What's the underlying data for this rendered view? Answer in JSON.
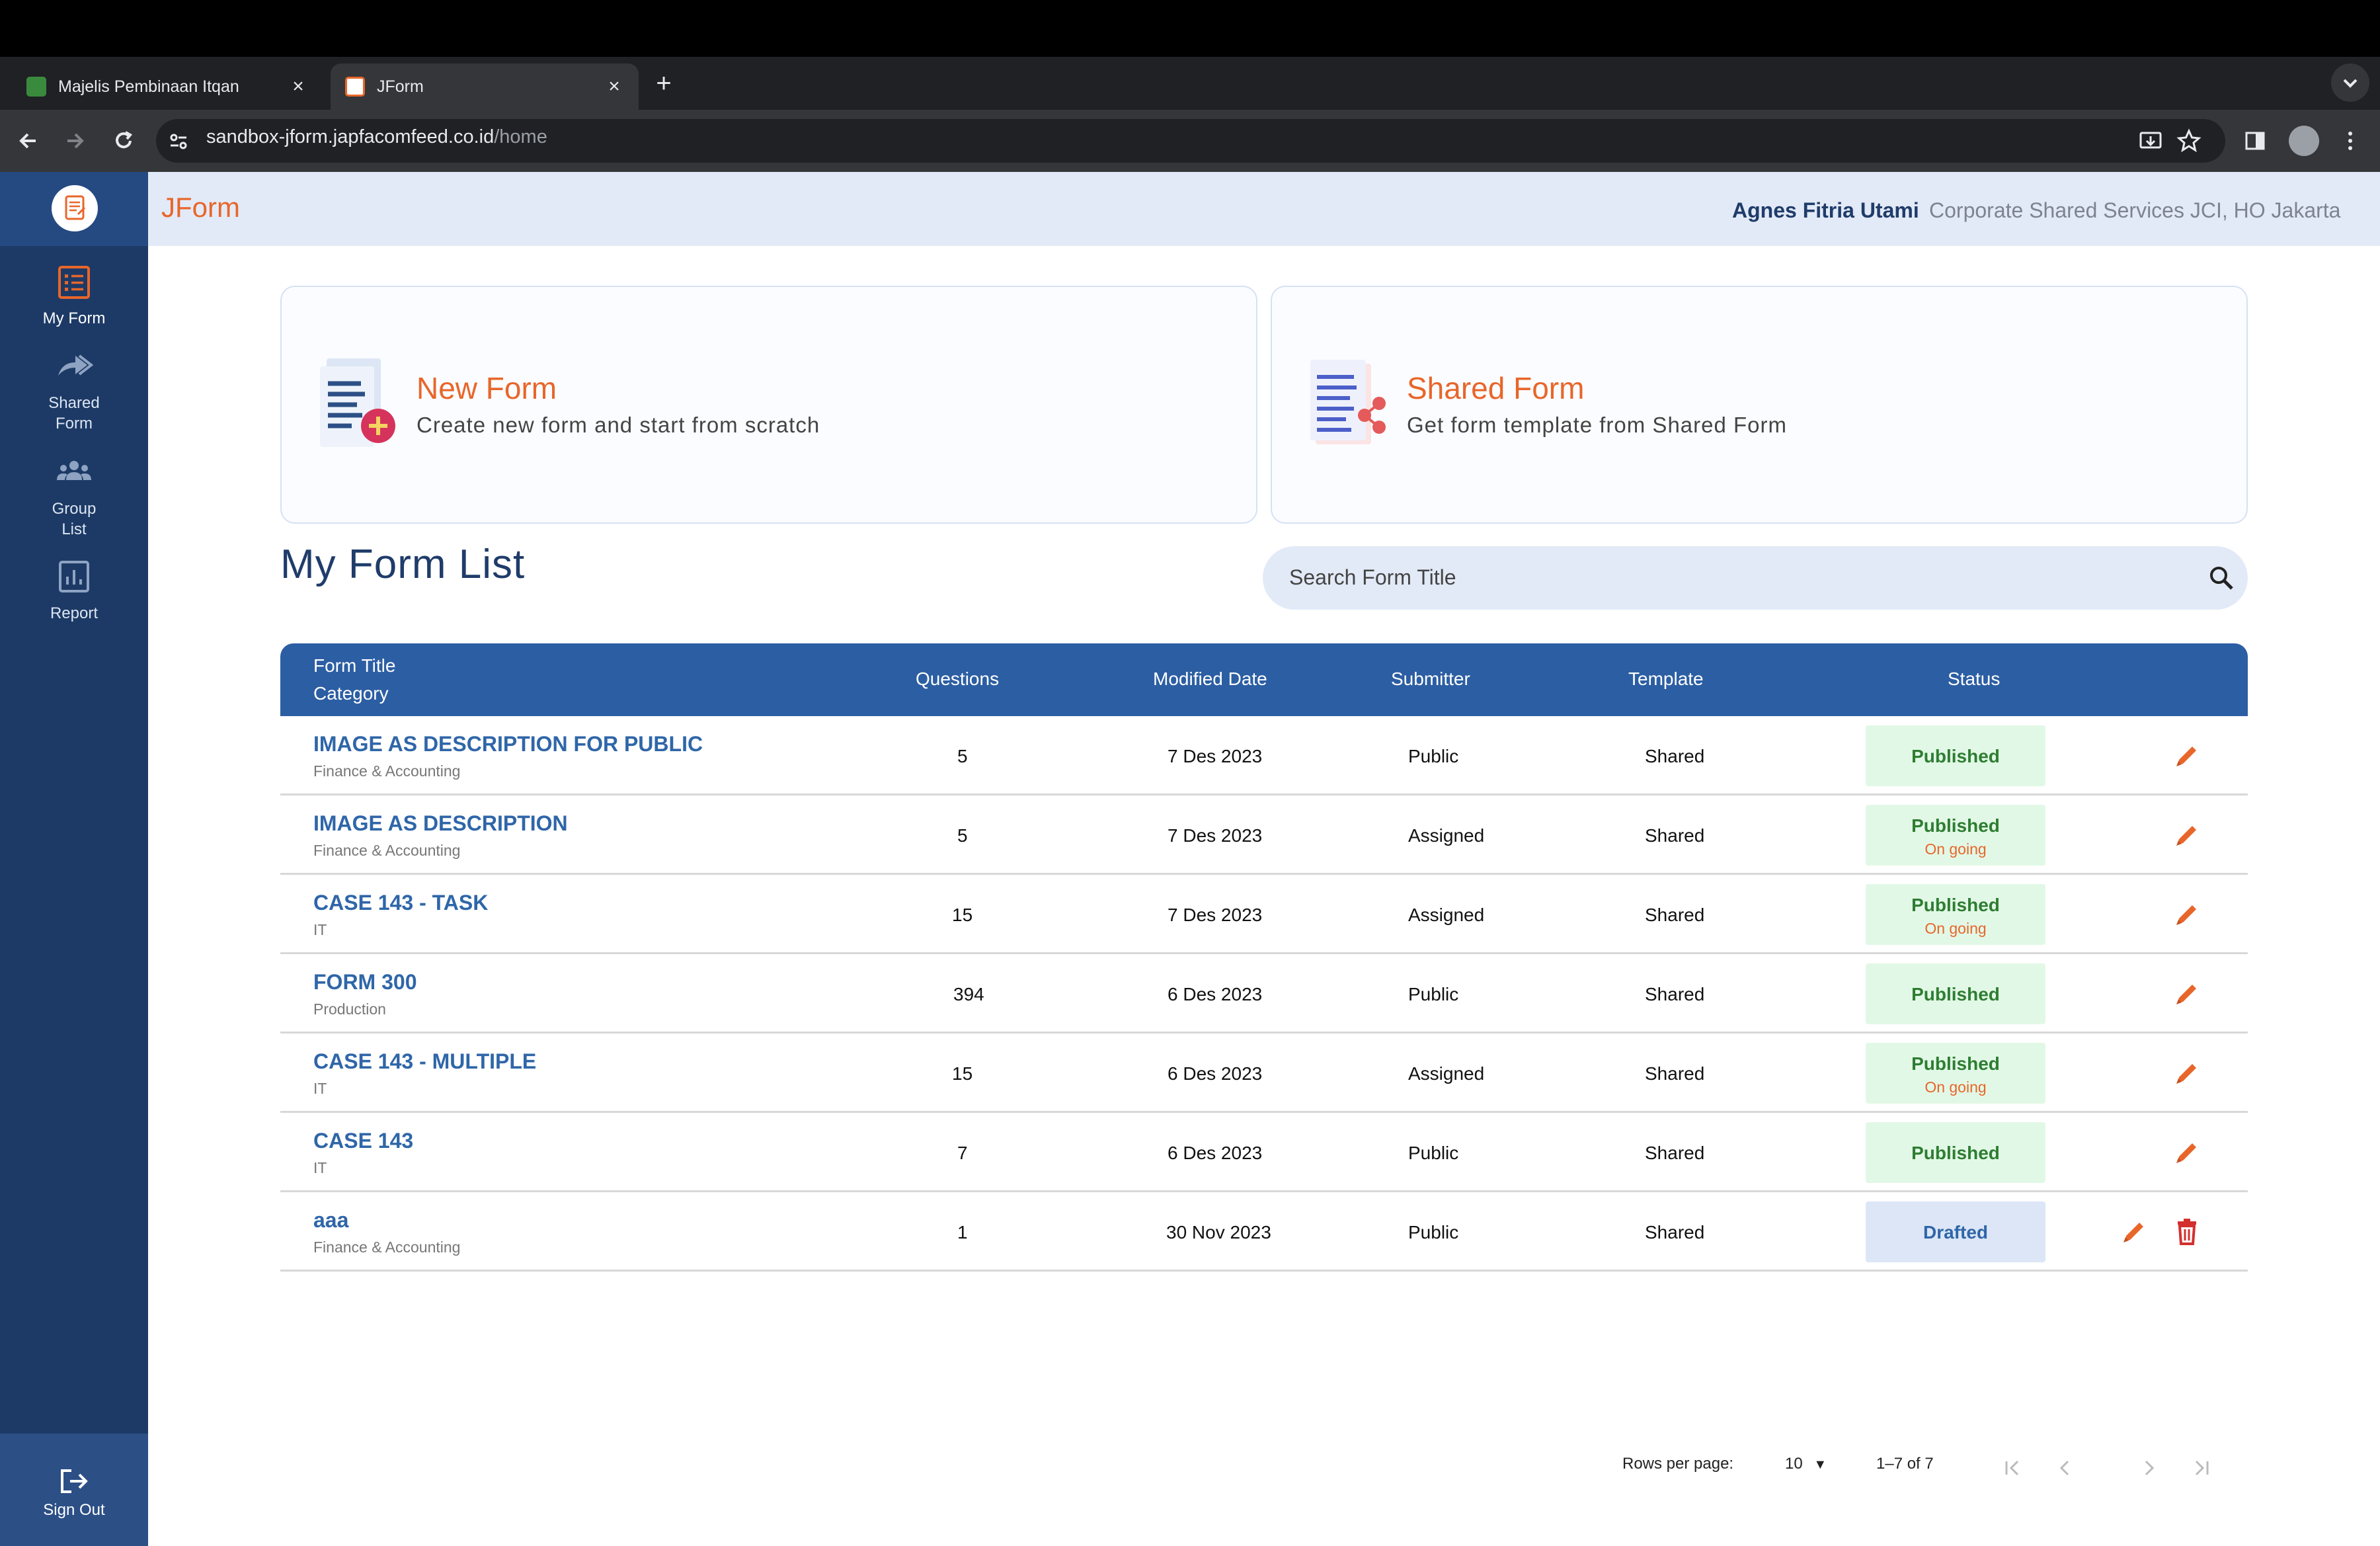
{
  "browser": {
    "tabs": [
      {
        "title": "Majelis Pembinaan Itqan",
        "active": false
      },
      {
        "title": "JForm",
        "active": true
      }
    ],
    "url_host": "sandbox-jform.japfacomfeed.co.id",
    "url_path": "/home"
  },
  "app": {
    "brand": "JForm",
    "user_name": "Agnes Fitria Utami",
    "user_org": "Corporate Shared Services JCI, HO Jakarta",
    "accent_color": "#e8662a",
    "primary_color": "#2c5ea3"
  },
  "sidebar": {
    "items": [
      {
        "label": "My Form",
        "icon": "list-icon",
        "active": true
      },
      {
        "label": "Shared Form",
        "icon": "share-arrows-icon",
        "active": false
      },
      {
        "label": "Group List",
        "icon": "group-icon",
        "active": false
      },
      {
        "label": "Report",
        "icon": "report-chart-icon",
        "active": false
      }
    ],
    "sign_out": "Sign Out"
  },
  "cards": {
    "new_form": {
      "title": "New Form",
      "subtitle": "Create new form and start from scratch"
    },
    "shared_form": {
      "title": "Shared Form",
      "subtitle": "Get form template from Shared Form"
    }
  },
  "list": {
    "title": "My Form List",
    "search_placeholder": "Search Form Title",
    "columns": {
      "title": "Form Title",
      "category": "Category",
      "questions": "Questions",
      "modified": "Modified Date",
      "submitter": "Submitter",
      "template": "Template",
      "status": "Status"
    },
    "rows": [
      {
        "title": "IMAGE AS DESCRIPTION FOR PUBLIC",
        "category": "Finance & Accounting",
        "questions": "5",
        "modified": "7 Des 2023",
        "submitter": "Public",
        "template": "Shared",
        "status": "Published",
        "substatus": ""
      },
      {
        "title": "IMAGE AS DESCRIPTION",
        "category": "Finance & Accounting",
        "questions": "5",
        "modified": "7 Des 2023",
        "submitter": "Assigned",
        "template": "Shared",
        "status": "Published",
        "substatus": "On going"
      },
      {
        "title": "CASE 143 - TASK",
        "category": "IT",
        "questions": "15",
        "modified": "7 Des 2023",
        "submitter": "Assigned",
        "template": "Shared",
        "status": "Published",
        "substatus": "On going"
      },
      {
        "title": "FORM 300",
        "category": "Production",
        "questions": "394",
        "modified": "6 Des 2023",
        "submitter": "Public",
        "template": "Shared",
        "status": "Published",
        "substatus": ""
      },
      {
        "title": "CASE 143 - MULTIPLE",
        "category": "IT",
        "questions": "15",
        "modified": "6 Des 2023",
        "submitter": "Assigned",
        "template": "Shared",
        "status": "Published",
        "substatus": "On going"
      },
      {
        "title": "CASE 143",
        "category": "IT",
        "questions": "7",
        "modified": "6 Des 2023",
        "submitter": "Public",
        "template": "Shared",
        "status": "Published",
        "substatus": ""
      },
      {
        "title": "aaa",
        "category": "Finance & Accounting",
        "questions": "1",
        "modified": "30 Nov 2023",
        "submitter": "Public",
        "template": "Shared",
        "status": "Drafted",
        "substatus": ""
      }
    ]
  },
  "pagination": {
    "rows_label": "Rows per page:",
    "rows_value": "10",
    "range": "1–7 of 7"
  }
}
